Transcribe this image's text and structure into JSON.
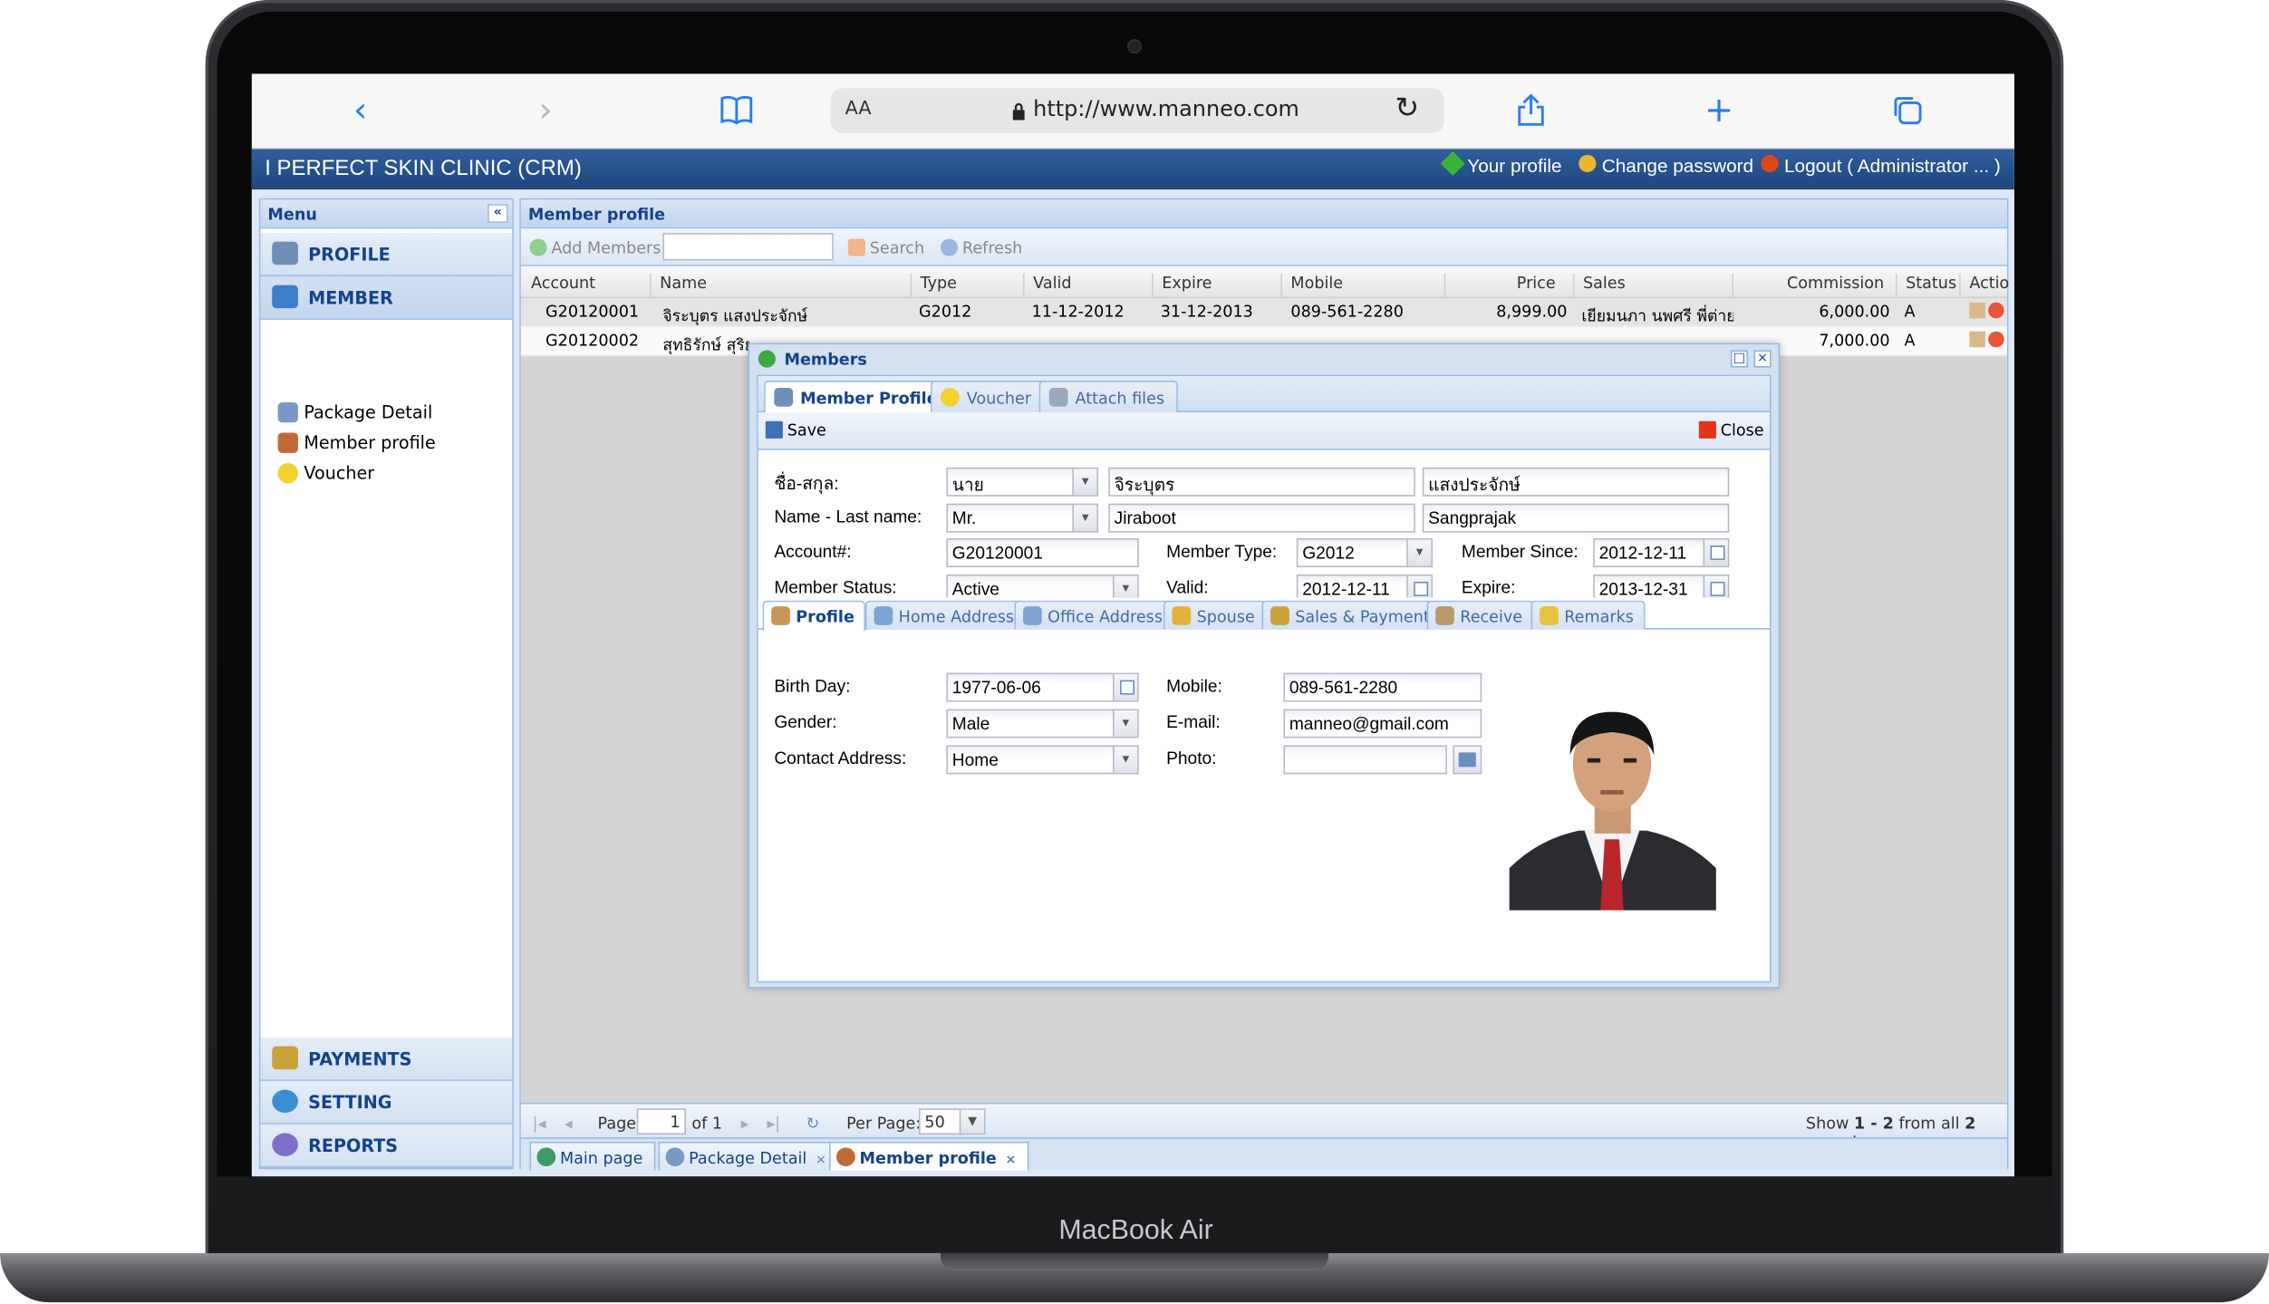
{
  "device": {
    "brand": "MacBook Air"
  },
  "browser": {
    "text_size_label": "AA",
    "url": "http://www.manneo.com",
    "icons": [
      "back-icon",
      "forward-icon",
      "bookmarks-icon",
      "reload-icon",
      "share-icon",
      "new-tab-icon",
      "tabs-icon"
    ]
  },
  "app": {
    "title": "I PERFECT SKIN CLINIC (CRM)",
    "header_links": {
      "profile": "Your profile",
      "change_password": "Change password",
      "logout": "Logout ( Administrator ... )"
    }
  },
  "menu": {
    "title": "Menu",
    "groups": {
      "profile": "PROFILE",
      "member": "MEMBER",
      "payments": "PAYMENTS",
      "setting": "SETTING",
      "reports": "REPORTS"
    },
    "member_items": [
      "Package Detail",
      "Member profile",
      "Voucher"
    ]
  },
  "panel": {
    "title": "Member profile",
    "add_label": "Add Members",
    "search_label": "Search",
    "refresh_label": "Refresh",
    "columns": [
      "Account",
      "Name",
      "Type",
      "Valid",
      "Expire",
      "Mobile",
      "Price",
      "Sales",
      "Commission",
      "Status",
      "Actio"
    ],
    "rows": [
      {
        "account": "G20120001",
        "name": "จิระบุตร แสงประจักษ์",
        "type": "G2012",
        "valid": "11-12-2012",
        "expire": "31-12-2013",
        "mobile": "089-561-2280",
        "price": "8,999.00",
        "sales": "เยียมนภา นพศรี พี่ต่าย",
        "commission": "6,000.00",
        "status": "A"
      },
      {
        "account": "G20120002",
        "name": "สุทธิรักษ์ สุริย",
        "type": "",
        "valid": "",
        "expire": "",
        "mobile": "",
        "price": "",
        "sales": "",
        "commission": "7,000.00",
        "status": "A"
      }
    ],
    "pager": {
      "page_label": "Page",
      "page": "1",
      "of": "of 1",
      "per_page_label": "Per Page:",
      "per_page": "50",
      "summary_prefix": "Show ",
      "summary_range": "1 - 2",
      "summary_mid": " from all ",
      "summary_total": "2",
      "summary_suffix": " records"
    }
  },
  "bottom_tabs": [
    "Main page",
    "Package Detail",
    "Member profile"
  ],
  "dialog": {
    "title": "Members",
    "tabs": [
      "Member Profile",
      "Voucher",
      "Attach files"
    ],
    "save_label": "Save",
    "close_label": "Close",
    "labels": {
      "thai_name": "ชื่อ-สกุล:",
      "name": "Name - Last name:",
      "account": "Account#:",
      "member_type": "Member Type:",
      "member_since": "Member Since:",
      "member_status": "Member Status:",
      "valid": "Valid:",
      "expire": "Expire:"
    },
    "values": {
      "thai_prefix": "นาย",
      "thai_first": "จิระบุตร",
      "thai_last": "แสงประจักษ์",
      "prefix": "Mr.",
      "first": "Jiraboot",
      "last": "Sangprajak",
      "account": "G20120001",
      "member_type": "G2012",
      "member_since": "2012-12-11",
      "member_status": "Active",
      "valid": "2012-12-11",
      "expire": "2013-12-31"
    },
    "subtabs": [
      "Profile",
      "Home Address",
      "Office Address",
      "Spouse",
      "Sales & Payment",
      "Receive",
      "Remarks"
    ],
    "profile": {
      "labels": {
        "birthday": "Birth Day:",
        "gender": "Gender:",
        "contact": "Contact Address:",
        "mobile": "Mobile:",
        "email": "E-mail:",
        "photo": "Photo:"
      },
      "values": {
        "birthday": "1977-06-06",
        "gender": "Male",
        "contact": "Home",
        "mobile": "089-561-2280",
        "email": "manneo@gmail.com",
        "photo": ""
      }
    }
  },
  "colors": {
    "header_blue": "#1e477d",
    "panel_text": "#15428b",
    "border": "#99bbe8"
  }
}
